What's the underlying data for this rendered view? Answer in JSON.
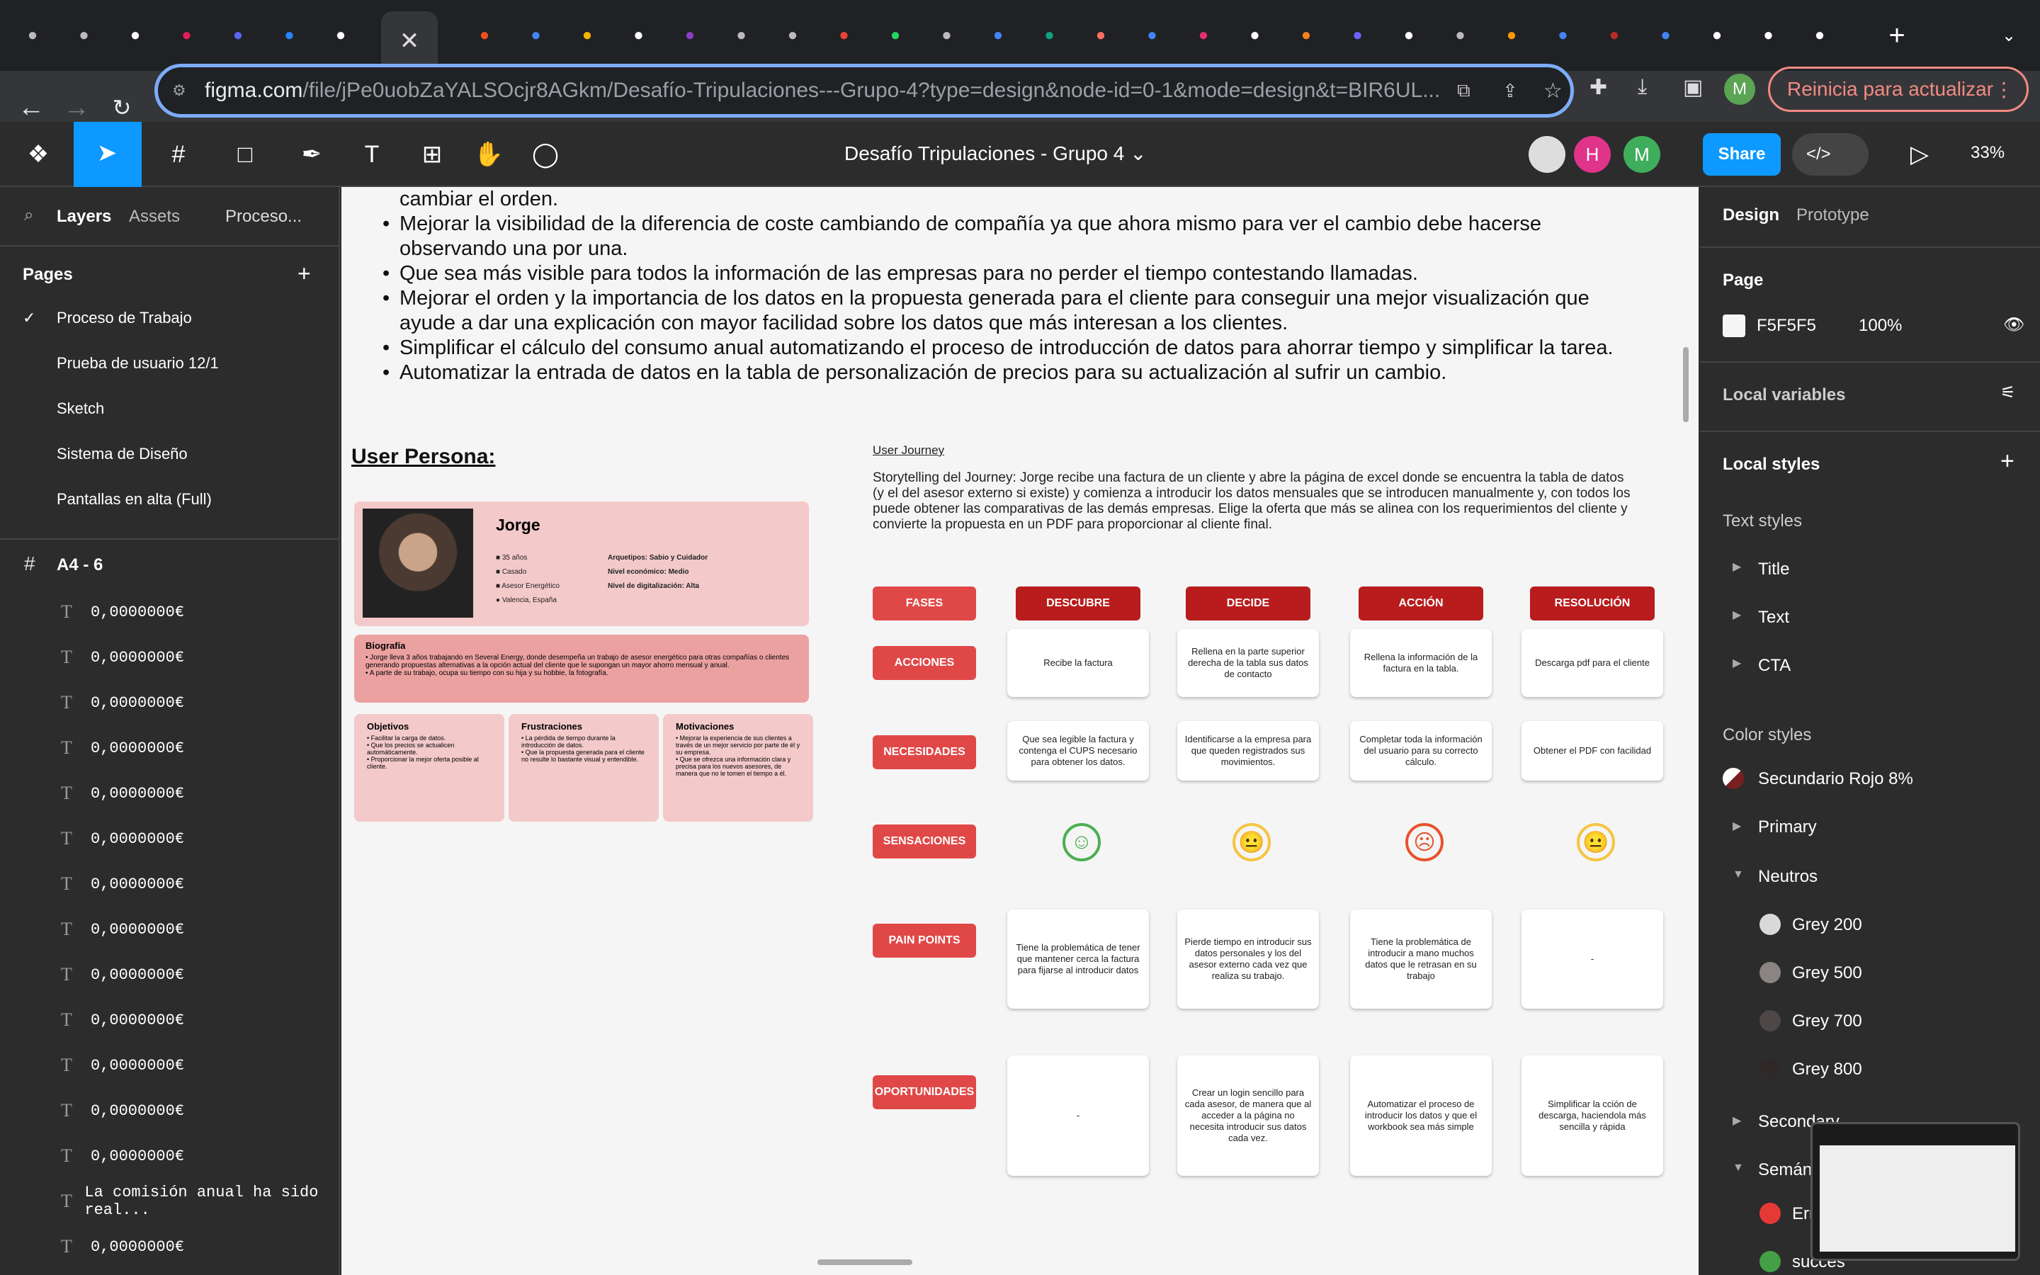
{
  "browser": {
    "tabs": [
      {
        "icon": "contacts-icon",
        "color": "#bbbbbb"
      },
      {
        "icon": "contacts-icon",
        "color": "#bbbbbb"
      },
      {
        "icon": "github-icon",
        "color": "#ffffff"
      },
      {
        "icon": "slack-icon",
        "color": "#e01e5a"
      },
      {
        "icon": "discord-icon",
        "color": "#5865f2"
      },
      {
        "icon": "jira-icon",
        "color": "#2684ff"
      },
      {
        "icon": "trello-icon",
        "color": "#ffffff"
      },
      {
        "icon": "figma-icon",
        "color": "#f24e1e"
      },
      {
        "icon": "figma-icon",
        "color": "#f24e1e"
      },
      {
        "icon": "docs-icon",
        "color": "#4285f4"
      },
      {
        "icon": "slides-icon",
        "color": "#f4b400"
      },
      {
        "icon": "github-icon",
        "color": "#ffffff"
      },
      {
        "icon": "tembo-icon",
        "color": "#8b3fc2"
      },
      {
        "icon": "globe-icon",
        "color": "#bbbbbb"
      },
      {
        "icon": "globe-icon",
        "color": "#bbbbbb"
      },
      {
        "icon": "gmail-icon",
        "color": "#ea4335"
      },
      {
        "icon": "whatsapp-icon",
        "color": "#25d366"
      },
      {
        "icon": "sync-icon",
        "color": "#bbbbbb"
      },
      {
        "icon": "google-icon",
        "color": "#4285f4"
      },
      {
        "icon": "chatgpt-icon",
        "color": "#10a37f"
      },
      {
        "icon": "colors-icon",
        "color": "#ff6f61"
      },
      {
        "icon": "google-icon",
        "color": "#4285f4"
      },
      {
        "icon": "instagram-icon",
        "color": "#e1306c"
      },
      {
        "icon": "apple-icon",
        "color": "#ffffff"
      },
      {
        "icon": "hk-icon",
        "color": "#f58220"
      },
      {
        "icon": "play-icon",
        "color": "#6c63ff"
      },
      {
        "icon": "openai-icon",
        "color": "#ffffff"
      },
      {
        "icon": "az-icon",
        "color": "#bbbbbb"
      },
      {
        "icon": "bingo-icon",
        "color": "#ff9800"
      },
      {
        "icon": "google-icon",
        "color": "#4285f4"
      },
      {
        "icon": "quora-icon",
        "color": "#b92b27"
      },
      {
        "icon": "google-icon",
        "color": "#4285f4"
      },
      {
        "icon": "r-icon",
        "color": "#ffffff"
      },
      {
        "icon": "apple-icon",
        "color": "#ffffff"
      },
      {
        "icon": "amazon-icon",
        "color": "#ffffff"
      }
    ],
    "url_domain": "figma.com",
    "url_rest": "/file/jPe0uobZaYALSOcjr8AGkm/Desafío-Tripulaciones---Grupo-4?type=design&node-id=0-1&mode=design&t=BIR6UL...",
    "profile_initial": "M",
    "update_label": "Reinicia para actualizar"
  },
  "figma": {
    "doc_title": "Desafío Tripulaciones - Grupo 4",
    "share_label": "Share",
    "zoom": "33%",
    "avatar_h": "H",
    "avatar_m": "M"
  },
  "left": {
    "tab_layers": "Layers",
    "tab_assets": "Assets",
    "tab_page": "Proceso...",
    "pages_title": "Pages",
    "pages": [
      "Proceso de Trabajo",
      "Prueba de usuario 12/1",
      "Sketch",
      "Sistema de Diseño",
      "Pantallas en alta (Full)"
    ],
    "frame": "A4 - 6",
    "layers": [
      "0,0000000€",
      "0,0000000€",
      "0,0000000€",
      "0,0000000€",
      "0,0000000€",
      "0,0000000€",
      "0,0000000€",
      "0,0000000€",
      "0,0000000€",
      "0,0000000€",
      "0,0000000€",
      "0,0000000€",
      "0,0000000€",
      "La comisión anual ha sido real...",
      "0,0000000€"
    ]
  },
  "canvas": {
    "bullets": [
      "cambiar el orden.",
      "Mejorar la visibilidad de la diferencia de coste cambiando de compañía ya que ahora mismo para ver el cambio debe hacerse",
      "observando una por una.",
      "Que sea más visible para todos la información de las empresas para no perder el tiempo contestando llamadas.",
      "Mejorar el orden y la importancia de los datos en la propuesta generada para el cliente para conseguir una mejor visualización que",
      "ayude a dar una explicación con mayor facilidad sobre los datos que más interesan a los clientes.",
      "Simplificar el cálculo del consumo anual automatizando el proceso de introducción de datos para ahorrar tiempo y simplificar la tarea.",
      "Automatizar la entrada de datos en la tabla de personalización de precios para su actualización al sufrir un cambio."
    ],
    "user_persona": "User Persona:",
    "persona": {
      "name": "Jorge",
      "age": "35 años",
      "status": "Casado",
      "job": "Asesor Energético",
      "place": "Valencia, España",
      "archetypes": "Arquetipos: Sabio y Cuidador",
      "economic": "Nivel económico: Medio",
      "digital": "Nivel de digitalización: Alta",
      "bio_title": "Biografía",
      "bio_1": "Jorge lleva 3 años trabajando en Several Energy, donde desempeña un trabajo de asesor energético para otras compañías o clientes generando propuestas alternativas a la opción actual del cliente que le supongan un mayor ahorro mensual y anual.",
      "bio_2": "A parte de su trabajo, ocupa su tiempo con su hija y su hobbie, la fotografía.",
      "obj_title": "Objetivos",
      "obj": [
        "Facilitar la carga de datos.",
        "Que los precios se actualicen automáticamente.",
        "Proporcionar la mejor oferta posible al cliente."
      ],
      "fru_title": "Frustraciones",
      "fru": [
        "La pérdida de tiempo durante la introducción de datos.",
        "Que la propuesta generada para el cliente no resulte lo bastante visual y entendible."
      ],
      "mot_title": "Motivaciones",
      "mot": [
        "Mejorar la experiencia de sus clientes a través de un mejor servicio por parte de él y su empresa.",
        "Que se ofrezca una información clara y precisa para los nuevos asesores, de manera que no le tomen el tiempo a él."
      ]
    },
    "journey_title": "User Journey",
    "story": [
      "Storytelling del Journey: Jorge recibe una factura de un cliente y abre la página de excel donde se encuentra la tabla de datos",
      "(y el del asesor externo si existe) y comienza a introducir los datos mensuales que se introducen manualmente y, con todos los",
      "puede obtener las comparativas de las demás empresas. Elige la oferta que más se alinea con los requerimientos del cliente y",
      "convierte la propuesta en un PDF para proporcionar al cliente final."
    ],
    "rows": [
      "FASES",
      "ACCIONES",
      "NECESIDADES",
      "SENSACIONES",
      "PAIN POINTS",
      "OPORTUNIDADES"
    ],
    "cols": [
      "DESCUBRE",
      "DECIDE",
      "ACCIÓN",
      "RESOLUCIÓN"
    ],
    "acciones": [
      "Recibe la factura",
      "Rellena en la parte superior derecha de la tabla sus datos de contacto",
      "Rellena la información de la factura en la tabla.",
      "Descarga pdf para el cliente"
    ],
    "necesidades": [
      "Que sea legible la factura y contenga el CUPS necesario para obtener los datos.",
      "Identificarse a la empresa para que queden registrados sus movimientos.",
      "Completar toda la información del usuario para su correcto cálculo.",
      "Obtener el PDF con facilidad"
    ],
    "sensaciones": [
      {
        "face": "☺",
        "color": "#4caf50"
      },
      {
        "face": "😐",
        "color": "#f5c542"
      },
      {
        "face": "☹",
        "color": "#e8522c"
      },
      {
        "face": "😐",
        "color": "#f5c542"
      }
    ],
    "pain": [
      "Tiene la problemática de tener que mantener cerca la factura para fijarse al introducir datos",
      "Pierde tiempo en introducir sus datos personales y los del asesor externo cada vez que realiza su trabajo.",
      "Tiene la problemática de introducir a mano muchos datos que le retrasan en su trabajo",
      "-"
    ],
    "oport": [
      "-",
      "Crear un login sencillo para cada asesor, de manera que al acceder a la página no necesita introducir sus datos cada vez.",
      "Automatizar el proceso de introducir los datos y que el workbook sea más simple",
      "Simplificar la cción de descarga, haciendola más sencilla y rápida"
    ]
  },
  "right": {
    "tab_design": "Design",
    "tab_proto": "Prototype",
    "page_title": "Page",
    "page_color": "F5F5F5",
    "page_opacity": "100%",
    "local_vars": "Local variables",
    "local_styles": "Local styles",
    "text_styles": "Text styles",
    "text_items": [
      "Title",
      "Text",
      "CTA"
    ],
    "color_styles": "Color styles",
    "sec_rojo": "Secundario Rojo 8%",
    "primary": "Primary",
    "neutros": "Neutros",
    "greys": [
      {
        "name": "Grey 200",
        "color": "#d9d9d9"
      },
      {
        "name": "Grey 500",
        "color": "#8a8483"
      },
      {
        "name": "Grey 700",
        "color": "#4d4747"
      },
      {
        "name": "Grey 800",
        "color": "#2e2828"
      }
    ],
    "secondary": "Secondary",
    "seman": "Semán",
    "error": "Err",
    "success": "succes"
  }
}
